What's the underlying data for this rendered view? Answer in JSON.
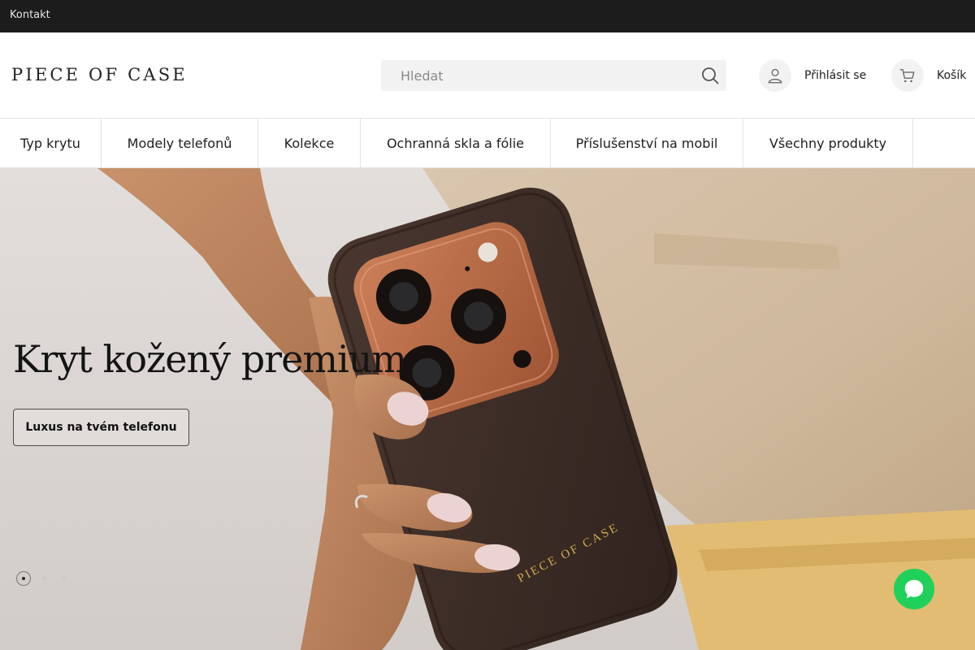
{
  "topbar": {
    "contact_label": "Kontakt"
  },
  "header": {
    "logo_text": "PIECE OF CASE",
    "search": {
      "placeholder": "Hledat",
      "value": "",
      "icon": "search-icon"
    },
    "account_label": "Přihlásit se",
    "cart_label": "Košík"
  },
  "nav": {
    "items": [
      {
        "label": "Typ krytu"
      },
      {
        "label": "Modely telefonů"
      },
      {
        "label": "Kolekce"
      },
      {
        "label": "Ochranná skla a fólie"
      },
      {
        "label": "Příslušenství na mobil"
      },
      {
        "label": "Všechny produkty"
      }
    ]
  },
  "hero": {
    "title": "Kryt kožený premium",
    "cta_label": "Luxus na tvém telefonu",
    "case_brand": "PIECE OF CASE",
    "slider": {
      "count": 3,
      "active": 1
    }
  },
  "colors": {
    "topbar_bg": "#1c1c1c",
    "search_bg": "#f2f2f2",
    "chat_green": "#1fd15a",
    "case_leather": "#3d2c25",
    "camera_copper": "#b96a43",
    "brand_gold": "#d2a94f"
  }
}
